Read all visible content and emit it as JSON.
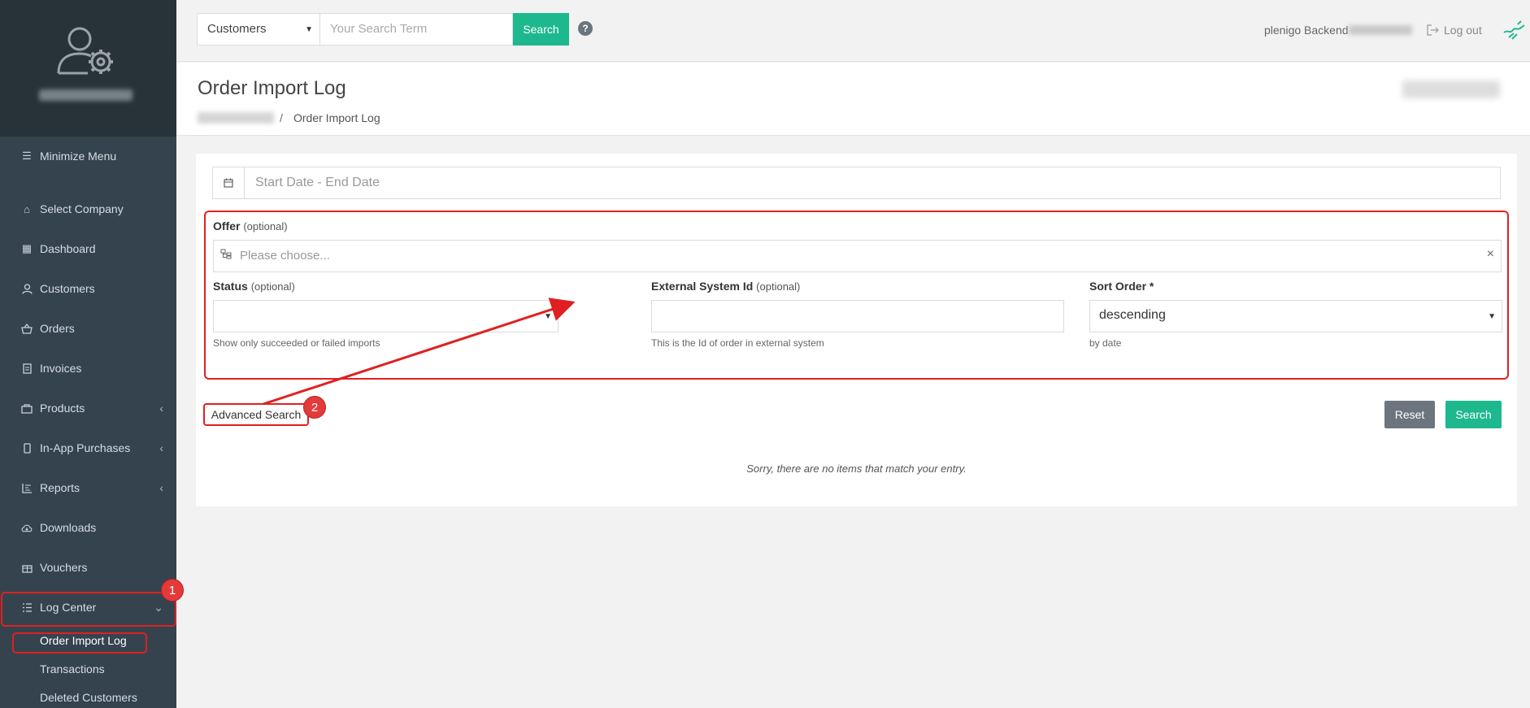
{
  "sidebar": {
    "minimize_label": "Minimize Menu",
    "items": [
      {
        "label": "Select Company",
        "icon": "home-icon"
      },
      {
        "label": "Dashboard",
        "icon": "grid-icon"
      },
      {
        "label": "Customers",
        "icon": "user-icon"
      },
      {
        "label": "Orders",
        "icon": "basket-icon"
      },
      {
        "label": "Invoices",
        "icon": "document-icon"
      },
      {
        "label": "Products",
        "icon": "box-icon"
      },
      {
        "label": "In-App Purchases",
        "icon": "mobile-icon"
      },
      {
        "label": "Reports",
        "icon": "chart-icon"
      },
      {
        "label": "Downloads",
        "icon": "cloud-download-icon"
      },
      {
        "label": "Vouchers",
        "icon": "gift-icon"
      },
      {
        "label": "Log Center",
        "icon": "list-icon"
      }
    ],
    "sub_items": [
      "Order Import Log",
      "Transactions",
      "Deleted Customers"
    ]
  },
  "topbar": {
    "scope_select": "Customers",
    "search_placeholder": "Your Search Term",
    "search_label": "Search",
    "help": "?",
    "backend_label": "plenigo Backend",
    "logout_label": "Log out"
  },
  "page": {
    "title": "Order Import Log",
    "breadcrumb_sep": "/",
    "breadcrumb_current": "Order Import Log"
  },
  "form": {
    "date_placeholder": "Start Date - End Date",
    "offer_label": "Offer",
    "optional": "(optional)",
    "offer_placeholder": "Please choose...",
    "clear": "×",
    "status_label": "Status",
    "status_help": "Show only succeeded or failed imports",
    "external_label": "External System Id",
    "external_help": "This is the Id of order in external system",
    "sort_label": "Sort Order",
    "required_mark": "*",
    "sort_value": "descending",
    "sort_help": "by date",
    "advanced_label": "Advanced Search",
    "reset_label": "Reset",
    "search_label": "Search",
    "empty_message": "Sorry, there are no items that match your entry."
  },
  "annotations": {
    "badge1": "1",
    "badge2": "2",
    "color": "#e02020"
  },
  "colors": {
    "accent": "#1eb88f",
    "sidebar": "#35434f",
    "sidebar_top": "#283239",
    "reset": "#6c757d"
  }
}
